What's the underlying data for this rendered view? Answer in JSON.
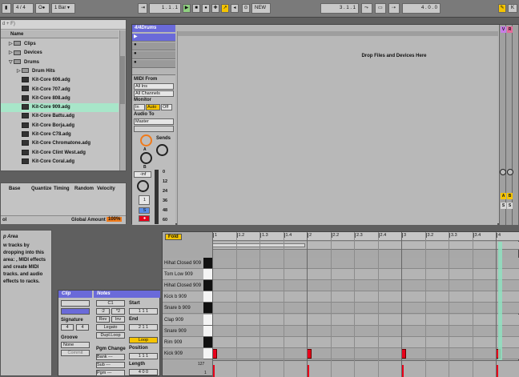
{
  "topbar": {
    "quantize": "4 / 4",
    "launch": "1 Bar",
    "arr_position": "1 . 1 . 1",
    "new_label": "NEW",
    "loop_start": "3 . 1 . 1",
    "loop_length": "4 . 0 . 0"
  },
  "browser": {
    "search": "d + F)",
    "header": "Name",
    "items": [
      {
        "label": "Clips",
        "kind": "folder",
        "fold": "▷",
        "indent": 10
      },
      {
        "label": "Devices",
        "kind": "folder",
        "fold": "▷",
        "indent": 10
      },
      {
        "label": "Drums",
        "kind": "folder",
        "fold": "▽",
        "indent": 10
      },
      {
        "label": "Drum Hits",
        "kind": "folder",
        "fold": "▷",
        "indent": 20
      },
      {
        "label": "Kit-Core 606.adg",
        "kind": "kit",
        "fold": "",
        "indent": 26
      },
      {
        "label": "Kit-Core 707.adg",
        "kind": "kit",
        "fold": "",
        "indent": 26
      },
      {
        "label": "Kit-Core 808.adg",
        "kind": "kit",
        "fold": "",
        "indent": 26
      },
      {
        "label": "Kit-Core 909.adg",
        "kind": "kit",
        "fold": "",
        "indent": 26,
        "selected": true
      },
      {
        "label": "Kit-Core Battu.adg",
        "kind": "kit",
        "fold": "",
        "indent": 26
      },
      {
        "label": "Kit-Core Borja.adg",
        "kind": "kit",
        "fold": "",
        "indent": 26
      },
      {
        "label": "Kit-Core C78.adg",
        "kind": "kit",
        "fold": "",
        "indent": 26
      },
      {
        "label": "Kit-Core Chromatone.adg",
        "kind": "kit",
        "fold": "",
        "indent": 26
      },
      {
        "label": "Kit-Core Clint West.adg",
        "kind": "kit",
        "fold": "",
        "indent": 26
      },
      {
        "label": "Kit-Core Coral.adg",
        "kind": "kit",
        "fold": "",
        "indent": 26
      }
    ]
  },
  "grooves": {
    "headers": [
      "Base",
      "Quantize",
      "Timing",
      "Random",
      "Velocity"
    ],
    "pool_label": "ol",
    "amount_label": "Global Amount",
    "amount_value": "100%"
  },
  "info": {
    "title": "p Area",
    "text": "w tracks by dropping into this area: , MIDI effects and create MIDI tracks. and audio effects to racks."
  },
  "track": {
    "name": "4/4Drums",
    "drop_text": "Drop Files and Devices Here",
    "midi_from_label": "MIDI From",
    "midi_from_value": "All Ins",
    "channel_value": "All Channels",
    "monitor_label": "Monitor",
    "monitor_in": "In",
    "monitor_auto": "Auto",
    "monitor_off": "Off",
    "audio_to_label": "Audio To",
    "audio_to_value": "Master",
    "sends_label": "Sends",
    "send_a": "A",
    "send_b": "B",
    "volume": "-inf",
    "track_number": "1",
    "solo": "S",
    "db_scale": [
      "0",
      "12",
      "24",
      "36",
      "48",
      "60"
    ]
  },
  "returns": {
    "labels": [
      "V",
      "R",
      "A",
      "B"
    ],
    "a": "A",
    "b": "B",
    "solo": "S"
  },
  "clipview": {
    "clip_tab": "Clip",
    "notes_tab": "Notes",
    "signature_label": "Signature",
    "sig_num": "4",
    "sig_den": "4",
    "groove_label": "Groove",
    "groove_value": "None",
    "commit": "Commit",
    "transpose": "C1",
    "half": ":2",
    "double": "*2",
    "rev": "Rev",
    "inv": "Inv",
    "legato": "Legato",
    "dupl_loop": "Dupl.Loop",
    "pgm_change": "Pgm Change",
    "bank": "Bank ---",
    "sub": "Sub ---",
    "pgm": "Pgm ---",
    "start_label": "Start",
    "start_value": "1 1 1",
    "end_label": "End",
    "end_value": "2 1 1",
    "loop_label": "Loop",
    "position_label": "Position",
    "position_value": "1 1 1",
    "length_label": "Length",
    "length_value": "4 0 0"
  },
  "pianoroll": {
    "fold": "Fold",
    "ruler": [
      "1",
      "1.2",
      "1.3",
      "1.4",
      "2",
      "2.2",
      "2.3",
      "2.4",
      "3",
      "3.2",
      "3.3",
      "3.4",
      "4"
    ],
    "rows": [
      "Hihat Closed 909",
      "Tom Low 909",
      "Hihat Closed 909",
      "Kick b 909",
      "Snare b 909",
      "Clap 909",
      "Snare 909",
      "Rim 909",
      "Kick 909"
    ],
    "velocity_top": "127",
    "velocity_bottom": "1"
  },
  "colors": {
    "track_blue": "#6a6ad9",
    "selection_green": "#a8e6c9",
    "note_red": "#e8001a",
    "accent_orange": "#f07a1a",
    "loop_yellow": "#f5c400"
  }
}
